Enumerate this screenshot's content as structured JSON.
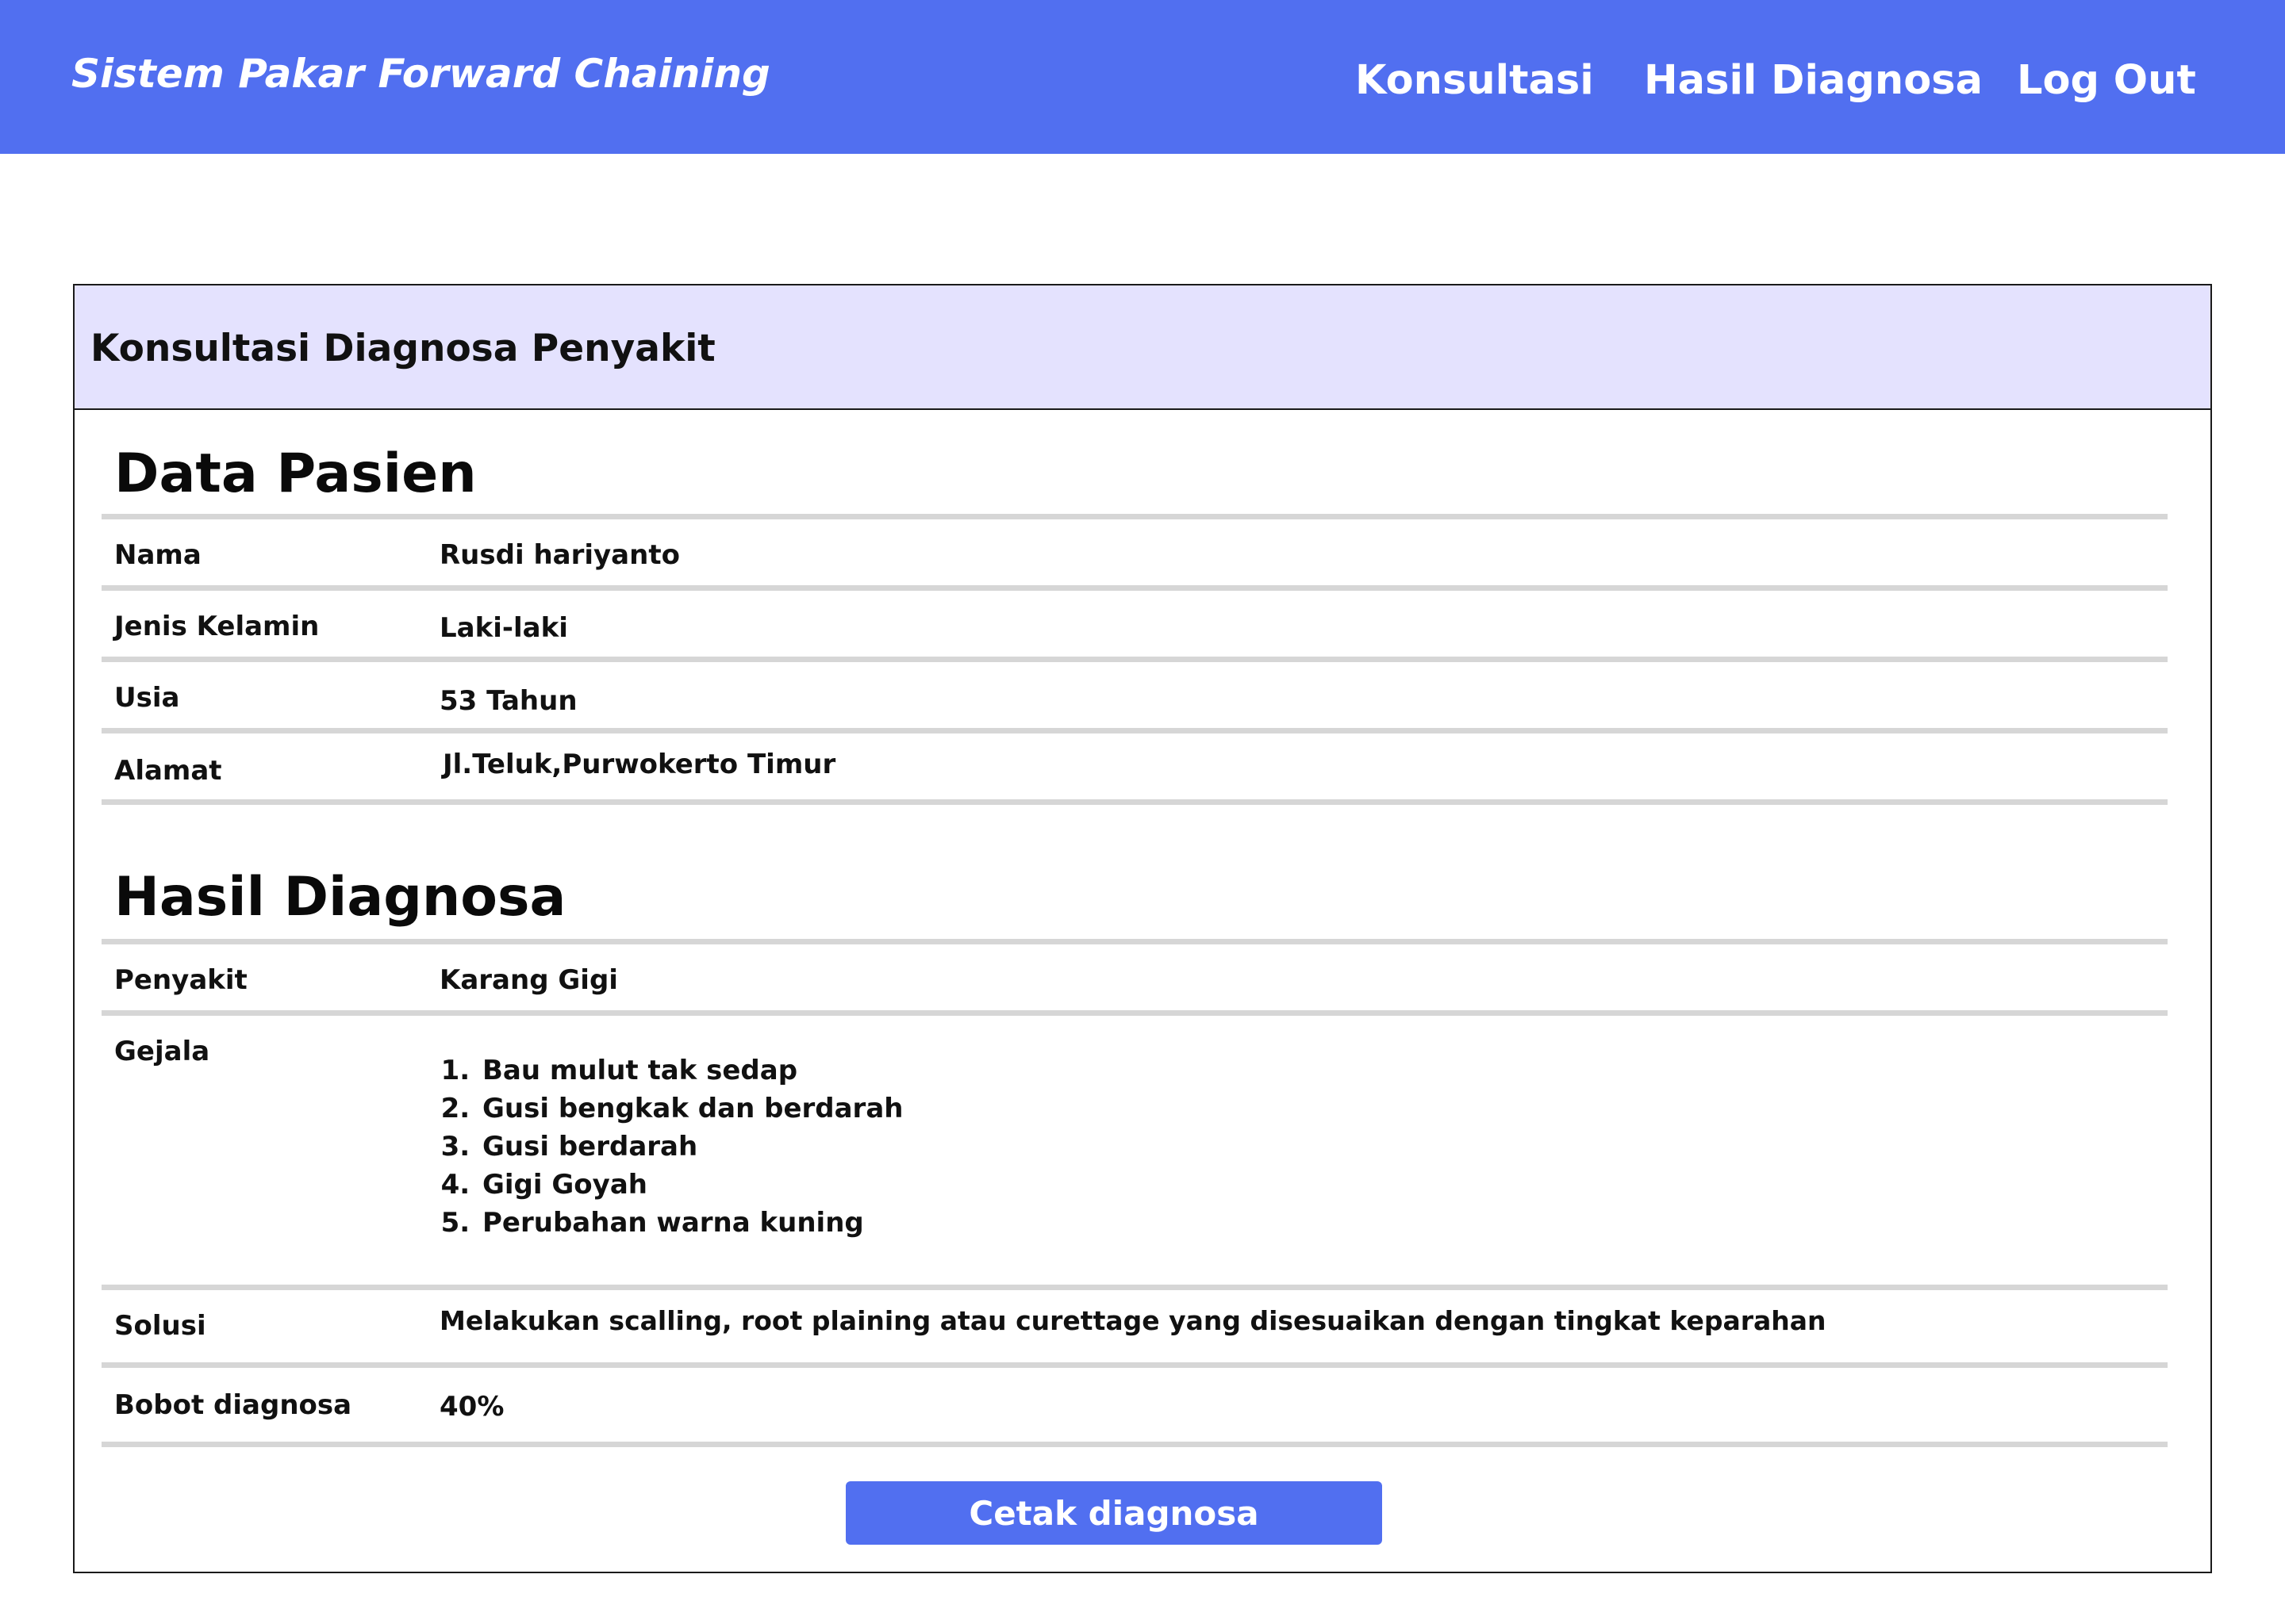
{
  "header": {
    "brand": "Sistem Pakar Forward Chaining",
    "nav": {
      "konsultasi": "Konsultasi",
      "hasil_diagnosa": "Hasil Diagnosa",
      "log_out": "Log Out"
    }
  },
  "card": {
    "title": "Konsultasi Diagnosa Penyakit"
  },
  "data_pasien": {
    "title": "Data Pasien",
    "rows": [
      {
        "label": "Nama",
        "value": "Rusdi hariyanto"
      },
      {
        "label": "Jenis Kelamin",
        "value": "Laki-laki"
      },
      {
        "label": "Usia",
        "value": "53 Tahun"
      },
      {
        "label": "Alamat",
        "value": "Jl.Teluk,Purwokerto Timur"
      }
    ]
  },
  "hasil_diagnosa": {
    "title": "Hasil Diagnosa",
    "penyakit_label": "Penyakit",
    "penyakit_value": "Karang Gigi",
    "gejala_label": "Gejala",
    "gejala_items": [
      "Bau mulut tak sedap",
      "Gusi bengkak dan berdarah",
      "Gusi berdarah",
      "Gigi Goyah",
      "Perubahan warna kuning"
    ],
    "solusi_label": "Solusi",
    "solusi_value": "Melakukan scalling, root plaining atau curettage yang disesuaikan dengan tingkat keparahan",
    "bobot_label": "Bobot diagnosa",
    "bobot_value": "40%"
  },
  "actions": {
    "cetak_label": "Cetak diagnosa"
  },
  "colors": {
    "primary": "#516ff0",
    "header_bg": "#e4e2fe",
    "rule": "#d6d6d6"
  }
}
